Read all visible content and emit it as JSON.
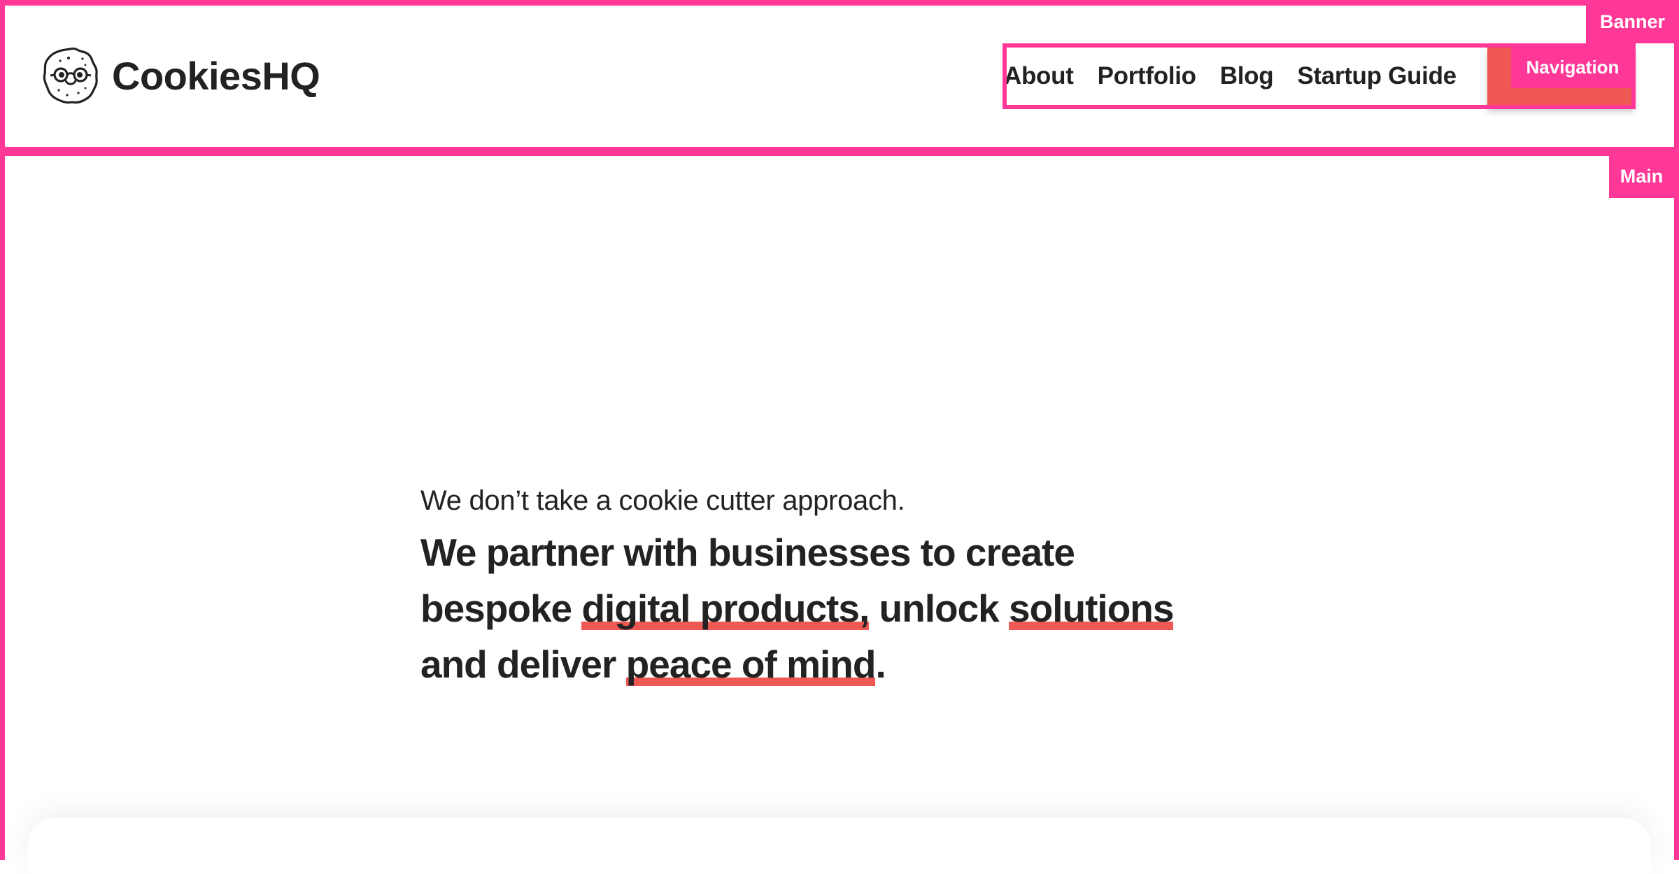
{
  "header": {
    "logo_text": "CookiesHQ",
    "logo_icon": "cookie-with-glasses-icon",
    "nav": {
      "items": [
        {
          "label": "About"
        },
        {
          "label": "Portfolio"
        },
        {
          "label": "Blog"
        },
        {
          "label": "Startup Guide"
        }
      ]
    }
  },
  "landmarks": {
    "banner": "Banner",
    "navigation": "Navigation",
    "main": "Main"
  },
  "hero": {
    "intro": "We don’t take a cookie cutter approach.",
    "headline": {
      "part1": "We partner with businesses to create bespoke ",
      "highlight1": "digital products,",
      "part2": " unlock ",
      "highlight2": "solutions",
      "part3": " and deliver ",
      "highlight3": "peace of mind",
      "part4": "."
    }
  },
  "colors": {
    "landmark_overlay": "#ff3796",
    "accent": "#ef5853",
    "text": "#222222",
    "background": "#ffffff"
  }
}
